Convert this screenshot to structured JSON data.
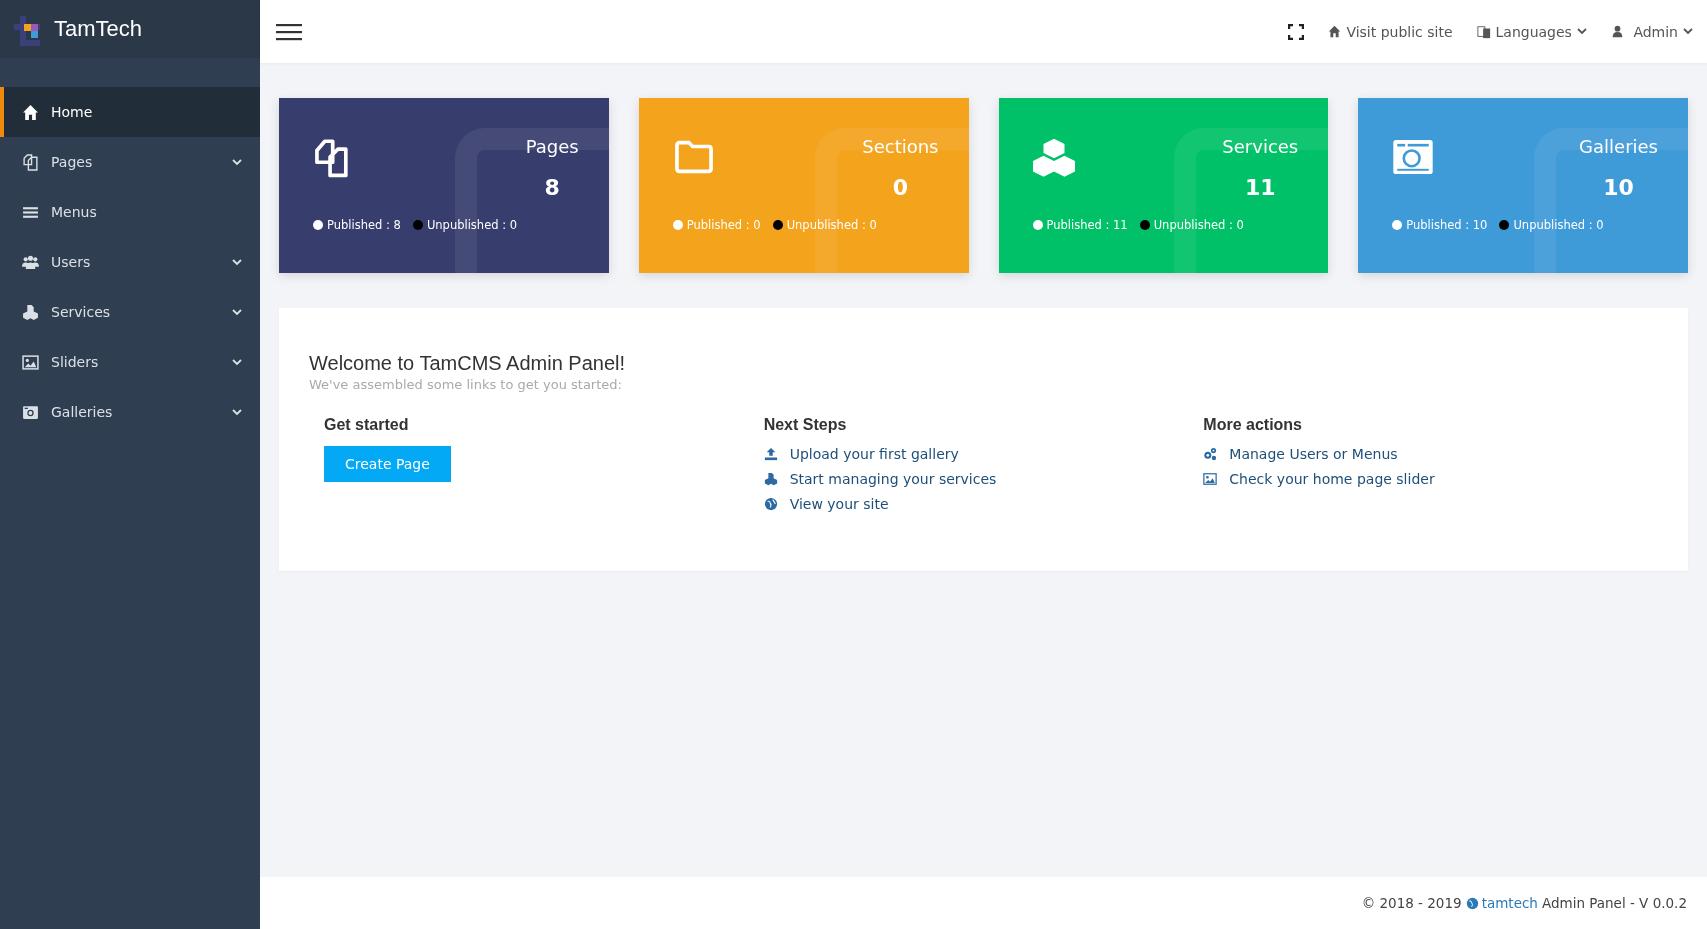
{
  "brand": {
    "name": "TamTech"
  },
  "sidebar": {
    "items": [
      {
        "label": "Home",
        "selected": true,
        "expandable": false
      },
      {
        "label": "Pages",
        "selected": false,
        "expandable": true
      },
      {
        "label": "Menus",
        "selected": false,
        "expandable": false
      },
      {
        "label": "Users",
        "selected": false,
        "expandable": true
      },
      {
        "label": "Services",
        "selected": false,
        "expandable": true
      },
      {
        "label": "Sliders",
        "selected": false,
        "expandable": true
      },
      {
        "label": "Galleries",
        "selected": false,
        "expandable": true
      }
    ]
  },
  "topbar": {
    "visit": "Visit public site",
    "languages": "Languages",
    "user": "Admin"
  },
  "cards": [
    {
      "title": "Pages",
      "count": "8",
      "published": "Published : 8",
      "unpublished": "Unpublished : 0",
      "color": "#373d6d"
    },
    {
      "title": "Sections",
      "count": "0",
      "published": "Published : 0",
      "unpublished": "Unpublished : 0",
      "color": "#f4a31c"
    },
    {
      "title": "Services",
      "count": "11",
      "published": "Published : 11",
      "unpublished": "Unpublished : 0",
      "color": "#00c167"
    },
    {
      "title": "Galleries",
      "count": "10",
      "published": "Published : 10",
      "unpublished": "Unpublished : 0",
      "color": "#3f9ad8"
    }
  ],
  "welcome": {
    "title": "Welcome to TamCMS Admin Panel!",
    "subtitle": "We've assembled some links to get you started:",
    "get_started": {
      "heading": "Get started",
      "button": "Create Page"
    },
    "next_steps": {
      "heading": "Next Steps",
      "links": [
        "Upload your first gallery",
        "Start managing your services",
        "View your site"
      ]
    },
    "more_actions": {
      "heading": "More actions",
      "links": [
        "Manage Users or Menus",
        "Check your home page slider"
      ]
    }
  },
  "footer": {
    "copyright": "© 2018 - 2019",
    "link": "tamtech",
    "suffix": "Admin Panel - V 0.0.2"
  }
}
